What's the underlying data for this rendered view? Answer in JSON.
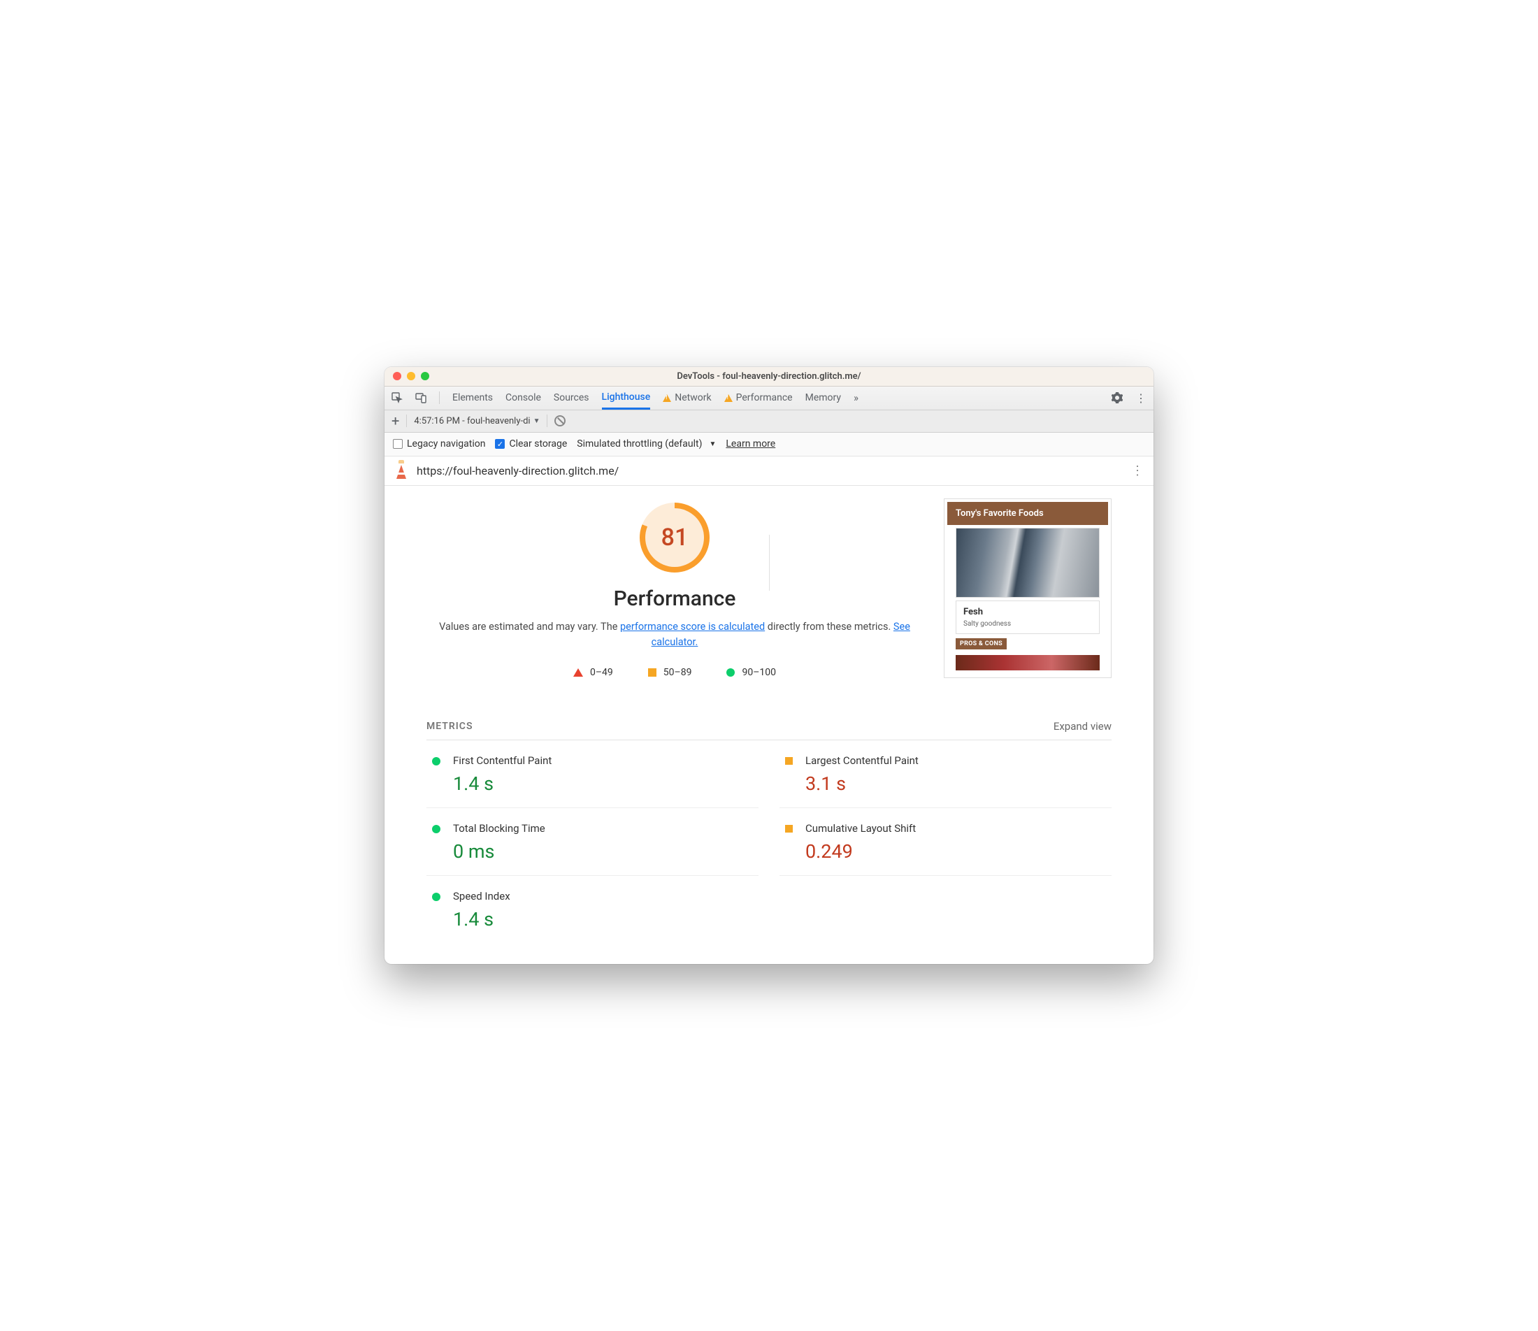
{
  "window": {
    "title": "DevTools - foul-heavenly-direction.glitch.me/"
  },
  "tabs": {
    "elements": "Elements",
    "console": "Console",
    "sources": "Sources",
    "lighthouse": "Lighthouse",
    "network": "Network",
    "performance": "Performance",
    "memory": "Memory"
  },
  "subbar": {
    "report_label": "4:57:16 PM - foul-heavenly-di",
    "legacy_label": "Legacy navigation",
    "clear_label": "Clear storage",
    "throttle_label": "Simulated throttling (default)",
    "learn_more": "Learn more"
  },
  "report": {
    "url": "https://foul-heavenly-direction.glitch.me/",
    "score": "81",
    "heading": "Performance",
    "desc_pre": "Values are estimated and may vary. The ",
    "desc_link1": "performance score is calculated",
    "desc_mid": " directly from these metrics. ",
    "desc_link2": "See calculator.",
    "legend": [
      "0–49",
      "50–89",
      "90–100"
    ]
  },
  "preview": {
    "title": "Tony's Favorite Foods",
    "card_title": "Fesh",
    "card_sub": "Salty goodness",
    "btn": "PROS & CONS"
  },
  "metrics": {
    "header": "METRICS",
    "expand": "Expand view",
    "items": [
      {
        "name": "First Contentful Paint",
        "value": "1.4 s",
        "status": "good"
      },
      {
        "name": "Largest Contentful Paint",
        "value": "3.1 s",
        "status": "avg"
      },
      {
        "name": "Total Blocking Time",
        "value": "0 ms",
        "status": "good"
      },
      {
        "name": "Cumulative Layout Shift",
        "value": "0.249",
        "status": "avg"
      },
      {
        "name": "Speed Index",
        "value": "1.4 s",
        "status": "good"
      }
    ]
  }
}
